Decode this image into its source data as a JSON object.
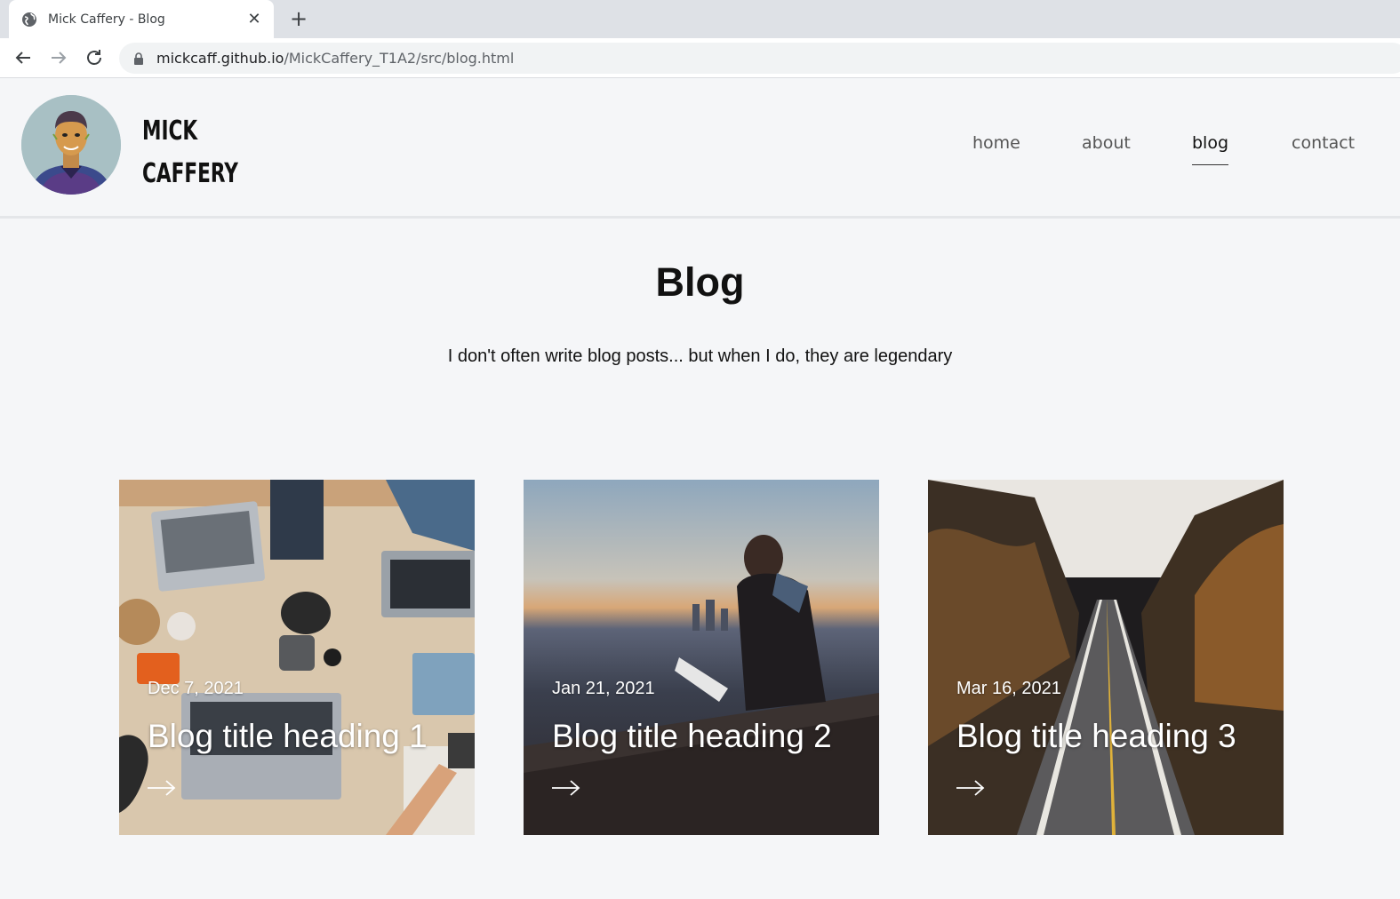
{
  "browser": {
    "tab_title": "Mick Caffery - Blog",
    "tab_close": "✕",
    "new_tab": "+",
    "url_host": "mickcaff.github.io",
    "url_path": "/MickCaffery_T1A2/src/blog.html"
  },
  "site": {
    "logo_line1": "MICK",
    "logo_line2": "CAFFERY",
    "nav": [
      {
        "label": "home",
        "active": false
      },
      {
        "label": "about",
        "active": false
      },
      {
        "label": "blog",
        "active": true
      },
      {
        "label": "contact",
        "active": false
      }
    ]
  },
  "main": {
    "title": "Blog",
    "subtitle": "I don't often write blog posts... but when I do, they are legendary"
  },
  "posts": [
    {
      "date": "Dec 7, 2021",
      "title": "Blog title heading 1",
      "arrow_icon": "arrow-right-icon"
    },
    {
      "date": "Jan 21, 2021",
      "title": "Blog title heading 2",
      "arrow_icon": "arrow-right-icon"
    },
    {
      "date": "Mar 16, 2021",
      "title": "Blog title heading 3",
      "arrow_icon": "arrow-right-icon"
    }
  ],
  "colors": {
    "page_bg": "#f5f6f8",
    "text": "#111111",
    "nav_inactive": "#555555",
    "card_text": "#ffffff"
  }
}
